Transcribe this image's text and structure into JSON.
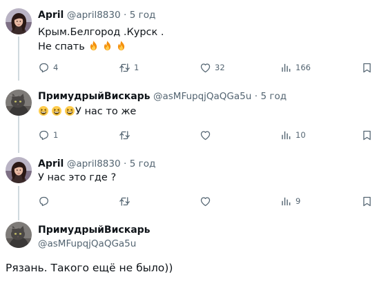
{
  "tweets": [
    {
      "name": "April",
      "handle": "@april8830",
      "separator": "·",
      "time": "5 год",
      "lines": [
        "Крым.Белгород .Курск .",
        "Не спать"
      ],
      "emoji": [
        "fire-emoji",
        "fire-emoji",
        "fire-emoji"
      ],
      "actions": {
        "reply": "4",
        "retweet": "1",
        "like": "32",
        "views": "166"
      }
    },
    {
      "name": "ПримудрыйВискарь",
      "handle": "@asMFupqjQaQGa5u",
      "separator": "·",
      "time": "5 год",
      "text": "У нас то же",
      "emoji": [
        "grinning-squinting-face-emoji",
        "grinning-squinting-face-emoji",
        "grinning-squinting-face-emoji"
      ],
      "actions": {
        "reply": "1",
        "retweet": "",
        "like": "",
        "views": "10"
      }
    },
    {
      "name": "April",
      "handle": "@april8830",
      "separator": "·",
      "time": "5 год",
      "text": "У нас это где ?",
      "actions": {
        "reply": "",
        "retweet": "",
        "like": "",
        "views": "9"
      }
    }
  ],
  "focused": {
    "name": "ПримудрыйВискарь",
    "handle": "@asMFupqjQaQGa5u",
    "text": "Рязань. Такого ещё не было))"
  },
  "icons": {
    "reply": "reply-icon",
    "retweet": "retweet-icon",
    "like": "like-icon",
    "views": "views-icon",
    "bookmark": "bookmark-icon"
  },
  "colors": {
    "text": "#0f1419",
    "secondary": "#536471",
    "thread_line": "#cfd9de",
    "background": "#ffffff"
  }
}
